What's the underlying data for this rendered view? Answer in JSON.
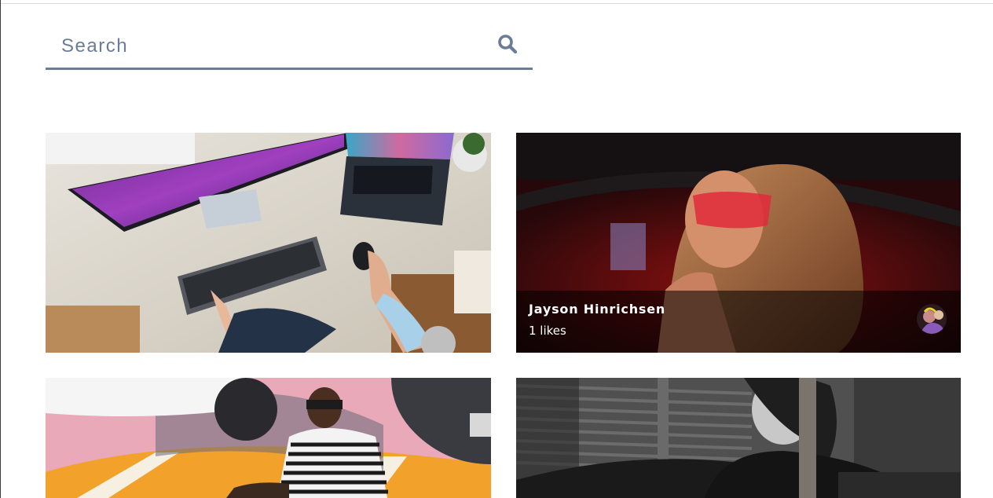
{
  "search": {
    "placeholder": "Search",
    "value": "",
    "icon": "search-icon"
  },
  "colors": {
    "accent": "#6b7c98",
    "overlay": "#000000",
    "text_on_overlay": "#ffffff"
  },
  "gallery": {
    "cards": [
      {
        "scene": "desk-workstation",
        "hover": false
      },
      {
        "scene": "woman-red-glasses-car",
        "hover": true,
        "author_name": "Jayson Hinrichsen",
        "likes_text": "1 likes",
        "avatar_icon": "user-avatar"
      },
      {
        "scene": "man-striped-shirt-parking",
        "hover": false
      },
      {
        "scene": "woman-monochrome",
        "hover": false
      }
    ]
  }
}
